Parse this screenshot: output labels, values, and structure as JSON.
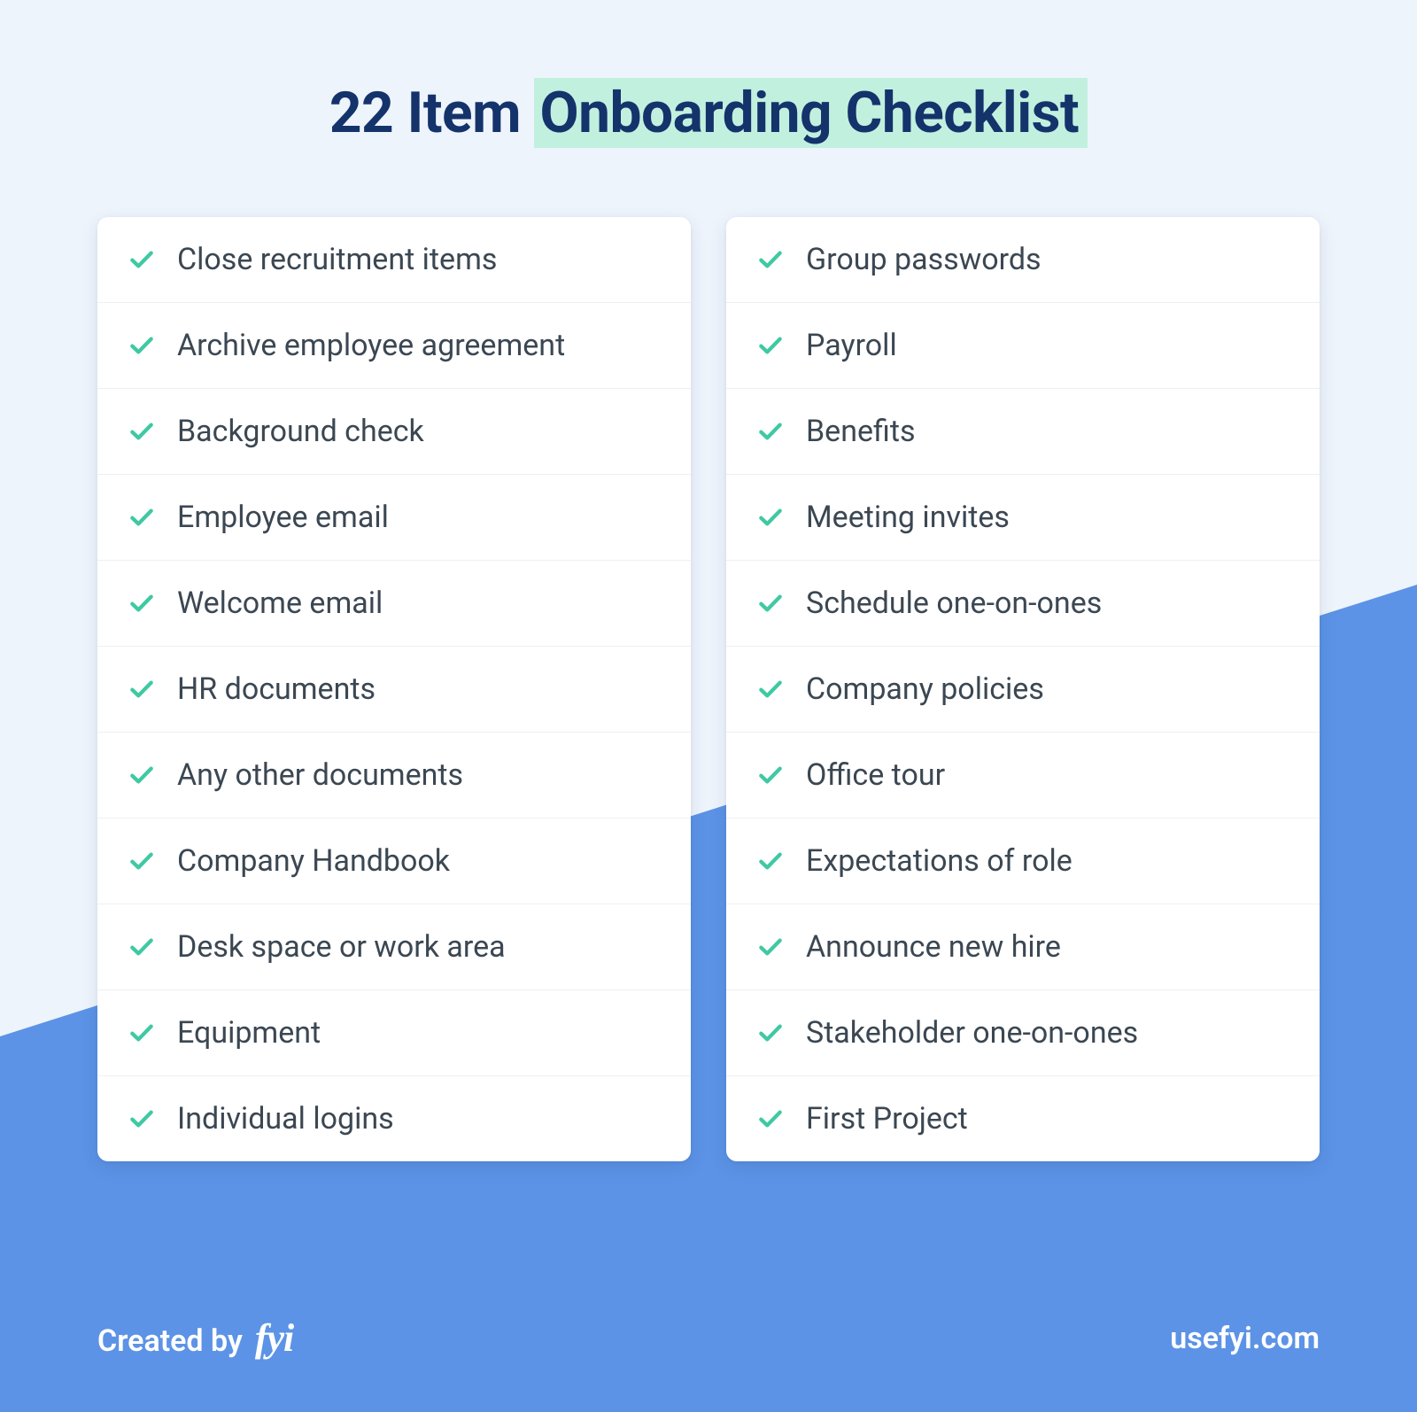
{
  "title_prefix": "22 Item ",
  "title_highlight": "Onboarding Checklist",
  "columns": [
    [
      "Close recruitment items",
      "Archive employee agreement",
      "Background check",
      "Employee email",
      "Welcome email",
      "HR documents",
      "Any other documents",
      "Company Handbook",
      "Desk space or work area",
      "Equipment",
      "Individual logins"
    ],
    [
      "Group passwords",
      "Payroll",
      "Benefits",
      "Meeting invites",
      "Schedule one-on-ones",
      "Company policies",
      "Office tour",
      "Expectations of role",
      "Announce new hire",
      "Stakeholder one-on-ones",
      "First Project"
    ]
  ],
  "footer": {
    "created_by": "Created by",
    "logo": "fyi",
    "site": "usefyi.com"
  }
}
